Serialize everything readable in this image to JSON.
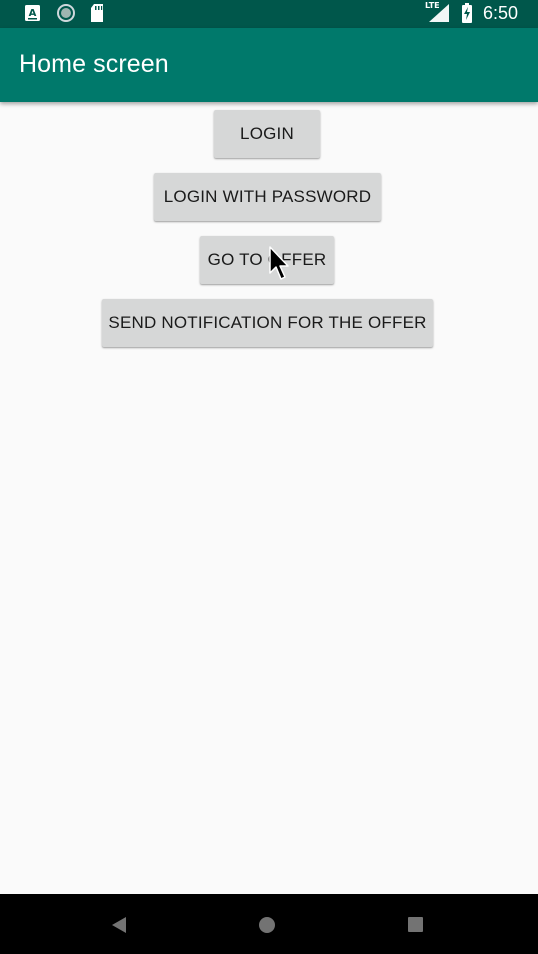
{
  "status_bar": {
    "time": "6:50",
    "network_label": "LTE",
    "icons": [
      "a-keyboard-icon",
      "sync-icon",
      "sd-card-icon",
      "signal-icon",
      "battery-icon"
    ],
    "colors": {
      "background": "#00574b"
    }
  },
  "app_bar": {
    "title": "Home screen",
    "colors": {
      "background": "#00796b",
      "text": "#ffffff"
    }
  },
  "buttons": {
    "login": "LOGIN",
    "login_with_password": "LOGIN WITH PASSWORD",
    "go_to_offer": "GO TO OFFER",
    "send_notification": "SEND NOTIFICATION FOR THE OFFER"
  },
  "nav_bar": {
    "icons": [
      "back-icon",
      "home-icon",
      "recent-apps-icon"
    ]
  }
}
